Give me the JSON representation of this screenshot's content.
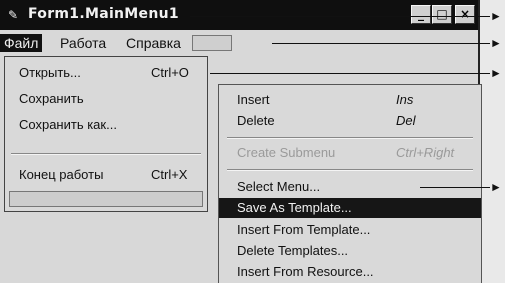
{
  "window": {
    "title": "Form1.MainMenu1",
    "buttons": {
      "minimize": "_",
      "maximize": "□",
      "close": "×"
    }
  },
  "menubar": {
    "items": [
      {
        "label": "Файл",
        "selected": true
      },
      {
        "label": "Работа"
      },
      {
        "label": "Справка"
      }
    ]
  },
  "file_menu": {
    "items": [
      {
        "label": "Открыть...",
        "shortcut": "Ctrl+O"
      },
      {
        "label": "Сохранить",
        "shortcut": ""
      },
      {
        "label": "Сохранить как...",
        "shortcut": ""
      },
      {
        "label": "Конец работы",
        "shortcut": "Ctrl+X"
      }
    ]
  },
  "context_menu": {
    "items": [
      {
        "label": "Insert",
        "shortcut": "Ins"
      },
      {
        "label": "Delete",
        "shortcut": "Del"
      },
      {
        "label": "Create Submenu",
        "shortcut": "Ctrl+Right",
        "disabled": true
      },
      {
        "label": "Select Menu...",
        "shortcut": ""
      },
      {
        "label": "Save As Template...",
        "shortcut": "",
        "selected": true
      },
      {
        "label": "Insert From Template...",
        "shortcut": ""
      },
      {
        "label": "Delete Templates...",
        "shortcut": ""
      },
      {
        "label": "Insert From Resource...",
        "shortcut": ""
      }
    ]
  },
  "icons": {
    "window_icon": "form-icon",
    "callout": "arrow-right-icon"
  },
  "colors": {
    "titlebar": "#0f0f0f",
    "selection": "#161616",
    "menu_bg": "#d9d9d9"
  }
}
